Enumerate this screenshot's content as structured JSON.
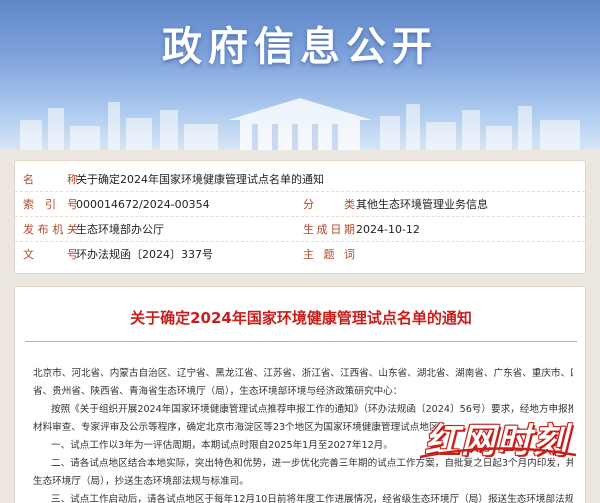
{
  "banner": {
    "title": "政府信息公开"
  },
  "meta": {
    "name_label": "名　称",
    "name_value": "关于确定2024年国家环境健康管理试点名单的通知",
    "index_label": "索引号",
    "index_value": "000014672/2024-00354",
    "category_label": "分　类",
    "category_value": "其他生态环境管理业务信息",
    "issuer_label": "发布机关",
    "issuer_value": "生态环境部办公厅",
    "date_label": "生成日期",
    "date_value": "2024-10-12",
    "docno_label": "文　号",
    "docno_value": "环办法规函〔2024〕337号",
    "subject_label": "主题词",
    "subject_value": ""
  },
  "doc": {
    "title": "关于确定2024年国家环境健康管理试点名单的通知",
    "p1_line1": "北京市、河北省、内蒙古自治区、辽宁省、黑龙江省、江苏省、浙江省、江西省、山东省、湖北省、湖南省、广东省、重庆市、四川",
    "p1_line2": "省、贵州省、陕西省、青海省生态环境厅（局），生态环境部环境与经济政策研究中心：",
    "p2_line1": "按照《关于组织开展2024年国家环境健康管理试点推荐申报工作的通知》（环办法规函〔2024〕56号）要求，经地方申报推荐、",
    "p2_line2": "材料审查、专家评审及公示等程序，确定北京市海淀区等23个地区为国家环境健康管理试点地区，",
    "p3": "一、试点工作以3年为一评估周期，本期试点时限自2025年1月至2027年12月。",
    "p4_line1": "二、请各试点地区结合本地实际，突出特色和优势，进一步优化完善三年期的试点工作方案，自批复之日起3个月内印发，并报省级",
    "p4_line2": "生态环境厅（局），抄送生态环境部法规与标准司。",
    "p5": "三、试点工作启动后，请各试点地区于每年12月10日前将年度工作进展情况，经省级生态环境厅（局）报送生态环境部法规与标准"
  },
  "watermark": {
    "text": "红网时刻"
  },
  "colors": {
    "label_red": "#b4472e",
    "title_red": "#c8201c",
    "banner_blue": "#6f95d2",
    "page_bg": "#ece7e1"
  }
}
